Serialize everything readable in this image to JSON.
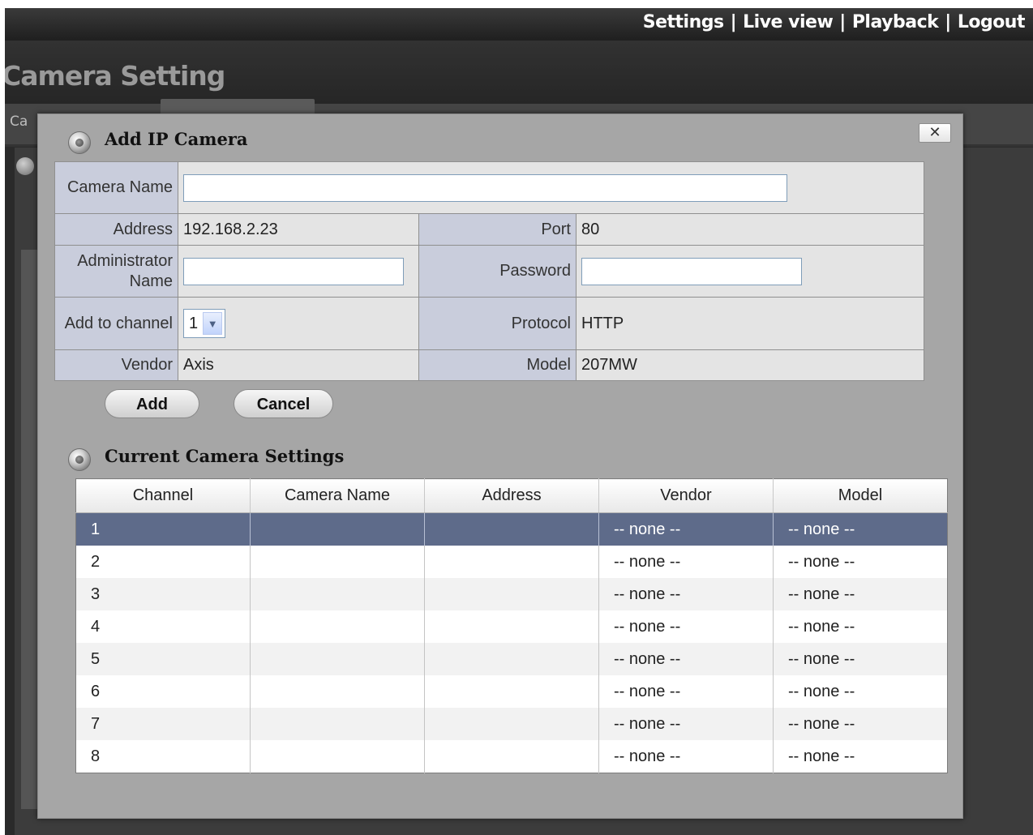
{
  "topnav": {
    "settings": "Settings",
    "live_view": "Live view",
    "playback": "Playback",
    "logout": "Logout",
    "separator": "|"
  },
  "page": {
    "title": "Camera Setting",
    "tab_partial": "Ca"
  },
  "modal": {
    "title": "Add IP Camera",
    "close_label": "✕",
    "icon": "camera-lens-icon",
    "form": {
      "camera_name_label": "Camera Name",
      "camera_name_value": "",
      "address_label": "Address",
      "address_value": "192.168.2.23",
      "port_label": "Port",
      "port_value": "80",
      "admin_name_label": "Administrator Name",
      "admin_name_value": "",
      "password_label": "Password",
      "password_value": "",
      "channel_label": "Add to channel",
      "channel_value": "1",
      "protocol_label": "Protocol",
      "protocol_value": "HTTP",
      "vendor_label": "Vendor",
      "vendor_value": "Axis",
      "model_label": "Model",
      "model_value": "207MW"
    },
    "buttons": {
      "add": "Add",
      "cancel": "Cancel"
    },
    "current": {
      "title": "Current Camera Settings",
      "columns": [
        "Channel",
        "Camera Name",
        "Address",
        "Vendor",
        "Model"
      ],
      "rows": [
        {
          "channel": "1",
          "camera_name": "",
          "address": "",
          "vendor": "-- none --",
          "model": "-- none --"
        },
        {
          "channel": "2",
          "camera_name": "",
          "address": "",
          "vendor": "-- none --",
          "model": "-- none --"
        },
        {
          "channel": "3",
          "camera_name": "",
          "address": "",
          "vendor": "-- none --",
          "model": "-- none --"
        },
        {
          "channel": "4",
          "camera_name": "",
          "address": "",
          "vendor": "-- none --",
          "model": "-- none --"
        },
        {
          "channel": "5",
          "camera_name": "",
          "address": "",
          "vendor": "-- none --",
          "model": "-- none --"
        },
        {
          "channel": "6",
          "camera_name": "",
          "address": "",
          "vendor": "-- none --",
          "model": "-- none --"
        },
        {
          "channel": "7",
          "camera_name": "",
          "address": "",
          "vendor": "-- none --",
          "model": "-- none --"
        },
        {
          "channel": "8",
          "camera_name": "",
          "address": "",
          "vendor": "-- none --",
          "model": "-- none --"
        }
      ]
    }
  },
  "colors": {
    "selected_row": "#5e6b8a",
    "label_cell": "#c9cddc",
    "modal_bg": "#a6a6a6"
  }
}
